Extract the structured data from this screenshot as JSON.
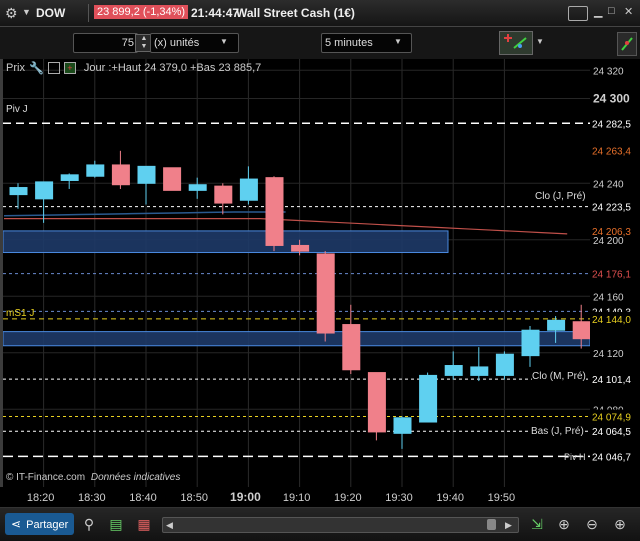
{
  "header": {
    "symbol": "DOW",
    "price_change": "23 899,2 (-1,34%)",
    "clock": "21:44:47",
    "instrument_title": "Wall Street Cash (1€)"
  },
  "controls": {
    "quantity_value": "75",
    "quantity_unit": "(x) unités",
    "timeframe": "5 minutes"
  },
  "chart_header": {
    "price_label": "Prix",
    "day_info": "Jour :+Haut 24 379,0 +Bas 23 885,7"
  },
  "level_labels": {
    "piv_j": "Piv J",
    "ms1_j": "mS1 J",
    "clo_j_pre": "Clo (J, Pré)",
    "clo_m_pre": "Clo (M, Pré)",
    "bas_j_pre": "Bas (J, Pré)",
    "piv_h": "Piv H"
  },
  "watermark": {
    "copyright": "© IT-Finance.com",
    "note": "Données indicatives"
  },
  "price_axis": {
    "ticks": [
      "24 320",
      "24 300",
      "24 240",
      "24 200",
      "24 160",
      "24 120",
      "24 080"
    ],
    "tags": [
      {
        "text": "24 282,5",
        "color": "#ffffff"
      },
      {
        "text": "24 263,4",
        "color": "#e8702a"
      },
      {
        "text": "24 223,5",
        "color": "#ffffff"
      },
      {
        "text": "24 206,3",
        "color": "#e8702a"
      },
      {
        "text": "24 176,1",
        "color": "#e05050"
      },
      {
        "text": "24 149,3",
        "color": "#ffffff"
      },
      {
        "text": "24 144,0",
        "color": "#e8d020"
      },
      {
        "text": "24 101,4",
        "color": "#ffffff"
      },
      {
        "text": "24 074,9",
        "color": "#e8d020"
      },
      {
        "text": "24 064,5",
        "color": "#ffffff"
      },
      {
        "text": "24 046,7",
        "color": "#ffffff"
      }
    ]
  },
  "time_axis": {
    "labels": [
      "18:20",
      "18:30",
      "18:40",
      "18:50",
      "19:00",
      "19:10",
      "19:20",
      "19:30",
      "19:40",
      "19:50"
    ]
  },
  "footer": {
    "share_label": "Partager"
  },
  "colors": {
    "up": "#5fd0f0",
    "down": "#f0808a",
    "zone": "#1e3a68",
    "zone_border": "#4a8ae0",
    "ma": "#c0504a",
    "ma2": "#2a5a90"
  },
  "chart_data": {
    "type": "candlestick",
    "title": "Wall Street Cash (1€)",
    "interval": "5 minutes",
    "ylim": [
      24025,
      24328
    ],
    "x": [
      "18:15",
      "18:20",
      "18:25",
      "18:30",
      "18:35",
      "18:40",
      "18:45",
      "18:50",
      "18:55",
      "19:00",
      "19:05",
      "19:10",
      "19:15",
      "19:20",
      "19:25",
      "19:30",
      "19:35",
      "19:40",
      "19:45",
      "19:50",
      "19:55",
      "20:00"
    ],
    "candles": [
      {
        "o": 24232,
        "h": 24240,
        "l": 24222,
        "c": 24237
      },
      {
        "o": 24229,
        "h": 24240,
        "l": 24212,
        "c": 24241
      },
      {
        "o": 24242,
        "h": 24247,
        "l": 24236,
        "c": 24246
      },
      {
        "o": 24245,
        "h": 24256,
        "l": 24244,
        "c": 24253
      },
      {
        "o": 24253,
        "h": 24263,
        "l": 24236,
        "c": 24239
      },
      {
        "o": 24240,
        "h": 24252,
        "l": 24225,
        "c": 24252
      },
      {
        "o": 24251,
        "h": 24251,
        "l": 24236,
        "c": 24235
      },
      {
        "o": 24235,
        "h": 24244,
        "l": 24229,
        "c": 24239
      },
      {
        "o": 24238,
        "h": 24240,
        "l": 24218,
        "c": 24226
      },
      {
        "o": 24228,
        "h": 24252,
        "l": 24225,
        "c": 24243
      },
      {
        "o": 24244,
        "h": 24245,
        "l": 24192,
        "c": 24196
      },
      {
        "o": 24196,
        "h": 24200,
        "l": 24189,
        "c": 24192
      },
      {
        "o": 24190,
        "h": 24192,
        "l": 24128,
        "c": 24134
      },
      {
        "o": 24140,
        "h": 24154,
        "l": 24105,
        "c": 24108
      },
      {
        "o": 24106,
        "h": 24106,
        "l": 24058,
        "c": 24064
      },
      {
        "o": 24063,
        "h": 24075,
        "l": 24052,
        "c": 24074
      },
      {
        "o": 24071,
        "h": 24106,
        "l": 24071,
        "c": 24104
      },
      {
        "o": 24104,
        "h": 24121,
        "l": 24101,
        "c": 24111
      },
      {
        "o": 24104,
        "h": 24124,
        "l": 24100,
        "c": 24110
      },
      {
        "o": 24104,
        "h": 24121,
        "l": 24101,
        "c": 24119
      },
      {
        "o": 24118,
        "h": 24139,
        "l": 24110,
        "c": 24136
      },
      {
        "o": 24136,
        "h": 24146,
        "l": 24127,
        "c": 24143
      },
      {
        "o": 24142,
        "h": 24154,
        "l": 24123,
        "c": 24130
      }
    ],
    "levels": [
      {
        "name": "Piv J",
        "value": 24282.5,
        "color": "#ffffff",
        "dash": "8,5"
      },
      {
        "name": "Clo (J, Pré)",
        "value": 24223.5,
        "color": "#ffffff",
        "dash": "3,3"
      },
      {
        "name": "mS1 J",
        "value": 24144.0,
        "color": "#e8d020",
        "dash": "5,4"
      },
      {
        "name": "Clo (M, Pré)",
        "value": 24101.4,
        "color": "#ffffff",
        "dash": "3,3"
      },
      {
        "name": "Bas (J, Pré)",
        "value": 24064.5,
        "color": "#ffffff",
        "dash": "3,3"
      },
      {
        "name": "Piv H",
        "value": 24046.7,
        "color": "#ffffff",
        "dash": "10,5"
      },
      {
        "name": "",
        "value": 24149.3,
        "color": "#6a8ad0",
        "dash": "3,3"
      },
      {
        "name": "",
        "value": 24176.1,
        "color": "#6a8ad0",
        "dash": "3,3"
      },
      {
        "name": "",
        "value": 24074.9,
        "color": "#e8d020",
        "dash": "3,3"
      }
    ],
    "zones": [
      {
        "from": 24206.3,
        "to": 24191,
        "x_from": "18:10",
        "x_to": "19:50"
      },
      {
        "from": 24135,
        "to": 24125,
        "x_from": "18:10",
        "x_to": "20:10"
      }
    ]
  }
}
